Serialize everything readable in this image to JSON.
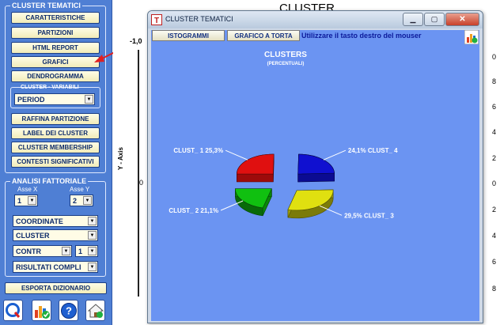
{
  "left_panel": {
    "cluster_tematici_title": "CLUSTER TEMATICI",
    "buttons_top": [
      "CARATTERISTICHE",
      "PARTIZIONI",
      "HTML REPORT",
      "GRAFICI",
      "DENDROGRAMMA"
    ],
    "cluster_variabili_title": "CLUSTER - VARIABILI",
    "period_select": "PERIOD",
    "buttons_mid": [
      "RAFFINA PARTIZIONE",
      "LABEL DEI CLUSTER",
      "CLUSTER MEMBERSHIP",
      "CONTESTI SIGNIFICATIVI"
    ],
    "analisi_title": "ANALISI FATTORIALE",
    "asse_x_label": "Asse X",
    "asse_y_label": "Asse Y",
    "asse_x_value": "1",
    "asse_y_value": "2",
    "coordinate_select": "COORDINATE",
    "cluster_select": "CLUSTER",
    "contr_select": "CONTR",
    "contr_num_select": "1",
    "risultati_select": "RISULTATI COMPLI",
    "esporta_button": "ESPORTA DIZIONARIO",
    "bottom_icons": [
      "quit-q-icon",
      "chart-check-icon",
      "help-icon",
      "home-icon"
    ]
  },
  "background_chart": {
    "title": "CLUSTER",
    "y_axis_label": "Y - Axis",
    "left_ticks": [
      "-1,0",
      "0"
    ],
    "right_ticks": [
      "0",
      "8",
      "6",
      "4",
      "2",
      "0",
      "2",
      "4",
      "6",
      "8"
    ]
  },
  "dialog": {
    "title": "CLUSTER TEMATICI",
    "tab_istogrammi": "ISTOGRAMMI",
    "tab_torta": "GRAFICO A TORTA",
    "hint": "Utilizzare il tasto destro del mouser",
    "window_buttons": [
      "minimize-icon",
      "maximize-icon",
      "close-icon"
    ]
  },
  "chart_data": {
    "type": "pie",
    "title": "CLUSTERS",
    "subtitle": "(PERCENTUALI)",
    "exploded": true,
    "three_d": true,
    "slices": [
      {
        "name": "CLUST_ 1",
        "label_text": "CLUST_ 1  25,3%",
        "value": 25.3,
        "color": "#e01010"
      },
      {
        "name": "CLUST_ 4",
        "label_text": "24,1%  CLUST_ 4",
        "value": 24.1,
        "color": "#1010d0"
      },
      {
        "name": "CLUST_ 3",
        "label_text": "29,5%  CLUST_ 3",
        "value": 29.5,
        "color": "#e0e010"
      },
      {
        "name": "CLUST_ 2",
        "label_text": "CLUST_ 2  21,1%",
        "value": 21.1,
        "color": "#10c010"
      }
    ]
  },
  "colors": {
    "panel_bg": "#4f7fd4",
    "dialog_bg": "#6b94f2",
    "arrow": "#e02020"
  }
}
